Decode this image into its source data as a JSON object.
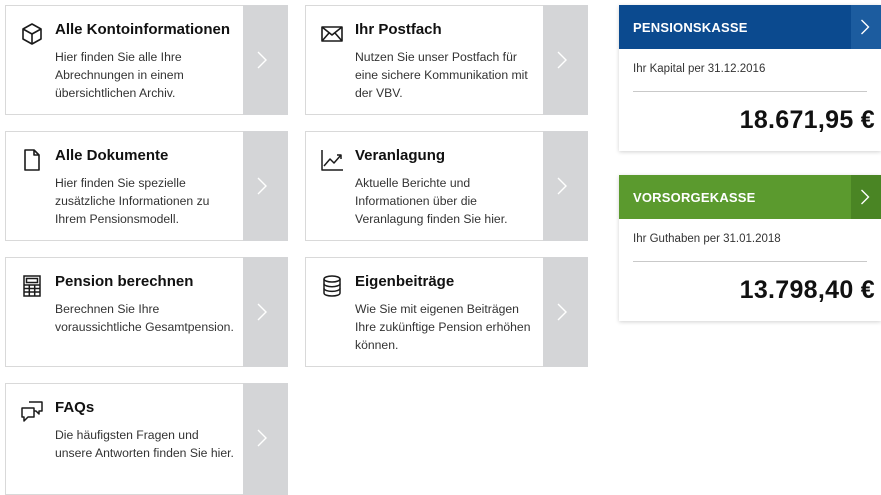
{
  "tiles": [
    {
      "title": "Alle Kontoinformationen",
      "desc": "Hier finden Sie alle Ihre Abrechnungen in einem übersichtlichen Archiv.",
      "icon": "cube-icon"
    },
    {
      "title": "Ihr Postfach",
      "desc": "Nutzen Sie unser Postfach für eine sichere Kommunikation mit der VBV.",
      "icon": "envelope-icon"
    },
    {
      "title": "Alle Dokumente",
      "desc": "Hier finden Sie spezielle zusätzliche Informationen zu Ihrem Pensionsmodell.",
      "icon": "document-icon"
    },
    {
      "title": "Veranlagung",
      "desc": "Aktuelle Berichte und Informationen über die Veranlagung finden Sie hier.",
      "icon": "trend-chart-icon"
    },
    {
      "title": "Pension berechnen",
      "desc": "Berechnen Sie Ihre voraussichtliche Gesamtpension.",
      "icon": "calculator-icon"
    },
    {
      "title": "Eigenbeiträge",
      "desc": "Wie Sie mit eigenen Beiträgen Ihre zukünftige Pension erhöhen können.",
      "icon": "database-icon"
    },
    {
      "title": "FAQs",
      "desc": "Die häufigsten Fragen und unsere Antworten finden Sie hier.",
      "icon": "chat-bubbles-icon"
    }
  ],
  "pensionskasse": {
    "title": "PENSIONSKASSE",
    "subtitle": "Ihr Kapital per 31.12.2016",
    "amount": "18.671,95 €",
    "color": "#0b4a8f",
    "chevron_color": "#1c5c9f"
  },
  "vorsorgekasse": {
    "title": "VORSORGEKASSE",
    "subtitle": "Ihr Guthaben per 31.01.2018",
    "amount": "13.798,40 €",
    "color": "#5b9a2e",
    "chevron_color": "#4a8524"
  },
  "colors": {
    "tile_arrow_bg": "#d4d5d7",
    "tile_border": "#d9d9d9"
  }
}
